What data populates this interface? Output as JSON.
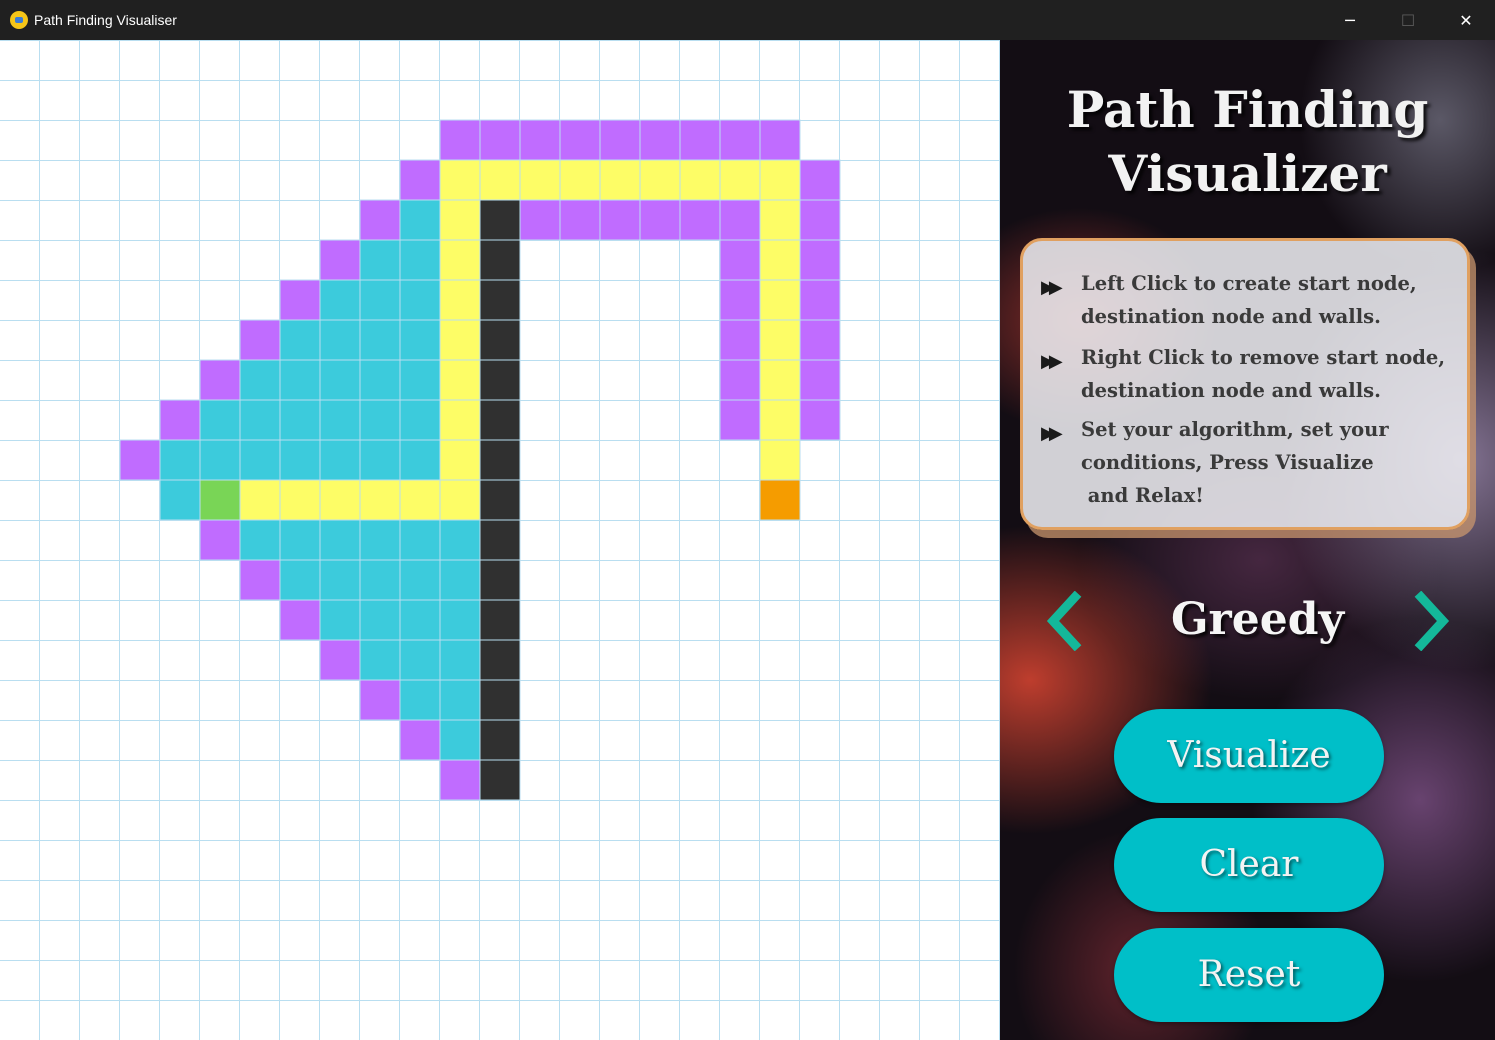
{
  "window": {
    "title": "Path Finding Visualiser",
    "controls": {
      "minimize": "─",
      "maximize": "☐",
      "close": "✕"
    }
  },
  "grid": {
    "cols": 25,
    "rows": 25,
    "colors": {
      "line": "#b9def0",
      "visited": "#c06cff",
      "explored": "#3ccbdc",
      "path": "#fdfd66",
      "wall": "#303030",
      "start": "#79d556",
      "end": "#f59c00"
    },
    "cells": {
      "visited": [
        [
          11,
          2
        ],
        [
          12,
          2
        ],
        [
          13,
          2
        ],
        [
          14,
          2
        ],
        [
          15,
          2
        ],
        [
          16,
          2
        ],
        [
          17,
          2
        ],
        [
          18,
          2
        ],
        [
          19,
          2
        ],
        [
          10,
          3
        ],
        [
          20,
          3
        ],
        [
          9,
          4
        ],
        [
          13,
          4
        ],
        [
          14,
          4
        ],
        [
          15,
          4
        ],
        [
          16,
          4
        ],
        [
          17,
          4
        ],
        [
          18,
          4
        ],
        [
          20,
          4
        ],
        [
          8,
          5
        ],
        [
          18,
          5
        ],
        [
          20,
          5
        ],
        [
          7,
          6
        ],
        [
          18,
          6
        ],
        [
          20,
          6
        ],
        [
          6,
          7
        ],
        [
          18,
          7
        ],
        [
          20,
          7
        ],
        [
          5,
          8
        ],
        [
          18,
          8
        ],
        [
          20,
          8
        ],
        [
          4,
          9
        ],
        [
          18,
          9
        ],
        [
          20,
          9
        ],
        [
          3,
          10
        ],
        [
          4,
          11
        ],
        [
          5,
          12
        ],
        [
          6,
          13
        ],
        [
          7,
          14
        ],
        [
          8,
          15
        ],
        [
          9,
          16
        ],
        [
          10,
          17
        ],
        [
          11,
          18
        ]
      ],
      "explored": [
        [
          10,
          4
        ],
        [
          9,
          5
        ],
        [
          10,
          5
        ],
        [
          8,
          6
        ],
        [
          9,
          6
        ],
        [
          10,
          6
        ],
        [
          7,
          7
        ],
        [
          8,
          7
        ],
        [
          9,
          7
        ],
        [
          10,
          7
        ],
        [
          6,
          8
        ],
        [
          7,
          8
        ],
        [
          8,
          8
        ],
        [
          9,
          8
        ],
        [
          10,
          8
        ],
        [
          5,
          9
        ],
        [
          6,
          9
        ],
        [
          7,
          9
        ],
        [
          8,
          9
        ],
        [
          9,
          9
        ],
        [
          10,
          9
        ],
        [
          4,
          10
        ],
        [
          5,
          10
        ],
        [
          6,
          10
        ],
        [
          7,
          10
        ],
        [
          8,
          10
        ],
        [
          9,
          10
        ],
        [
          10,
          10
        ],
        [
          4,
          11
        ],
        [
          5,
          11
        ],
        [
          6,
          11
        ],
        [
          7,
          11
        ],
        [
          8,
          11
        ],
        [
          9,
          11
        ],
        [
          10,
          11
        ],
        [
          11,
          11
        ],
        [
          6,
          12
        ],
        [
          7,
          12
        ],
        [
          8,
          12
        ],
        [
          9,
          12
        ],
        [
          10,
          12
        ],
        [
          11,
          12
        ],
        [
          7,
          13
        ],
        [
          8,
          13
        ],
        [
          9,
          13
        ],
        [
          10,
          13
        ],
        [
          11,
          13
        ],
        [
          8,
          14
        ],
        [
          9,
          14
        ],
        [
          10,
          14
        ],
        [
          11,
          14
        ],
        [
          9,
          15
        ],
        [
          10,
          15
        ],
        [
          11,
          15
        ],
        [
          10,
          16
        ],
        [
          11,
          16
        ],
        [
          11,
          17
        ]
      ],
      "path": [
        [
          11,
          3
        ],
        [
          12,
          3
        ],
        [
          13,
          3
        ],
        [
          14,
          3
        ],
        [
          15,
          3
        ],
        [
          16,
          3
        ],
        [
          17,
          3
        ],
        [
          18,
          3
        ],
        [
          19,
          3
        ],
        [
          11,
          4
        ],
        [
          19,
          4
        ],
        [
          11,
          5
        ],
        [
          19,
          5
        ],
        [
          11,
          6
        ],
        [
          19,
          6
        ],
        [
          11,
          7
        ],
        [
          19,
          7
        ],
        [
          11,
          8
        ],
        [
          19,
          8
        ],
        [
          11,
          9
        ],
        [
          19,
          9
        ],
        [
          11,
          10
        ],
        [
          19,
          10
        ],
        [
          6,
          11
        ],
        [
          7,
          11
        ],
        [
          8,
          11
        ],
        [
          9,
          11
        ],
        [
          10,
          11
        ],
        [
          11,
          11
        ]
      ],
      "wall": [
        [
          12,
          4
        ],
        [
          12,
          5
        ],
        [
          12,
          6
        ],
        [
          12,
          7
        ],
        [
          12,
          8
        ],
        [
          12,
          9
        ],
        [
          12,
          10
        ],
        [
          12,
          11
        ],
        [
          12,
          12
        ],
        [
          12,
          13
        ],
        [
          12,
          14
        ],
        [
          12,
          15
        ],
        [
          12,
          16
        ],
        [
          12,
          17
        ],
        [
          12,
          18
        ]
      ],
      "start": [
        [
          5,
          11
        ]
      ],
      "end": [
        [
          19,
          11
        ]
      ]
    }
  },
  "panel": {
    "title_line1": "Path Finding",
    "title_line2": "Visualizer",
    "instructions": [
      {
        "bullet": "▶▶",
        "text": "Left Click to create start node,\ndestination node and walls."
      },
      {
        "bullet": "▶▶",
        "text": "Right Click to remove start node,\ndestination node and walls."
      },
      {
        "bullet": "▶▶",
        "text": "Set your algorithm, set your\nconditions, Press Visualize\n and Relax!"
      }
    ],
    "algorithm": "Greedy",
    "arrow_color": "#14b89a",
    "buttons": {
      "visualize": "Visualize",
      "clear": "Clear",
      "reset": "Reset"
    },
    "button_color": "#00bfc8"
  }
}
